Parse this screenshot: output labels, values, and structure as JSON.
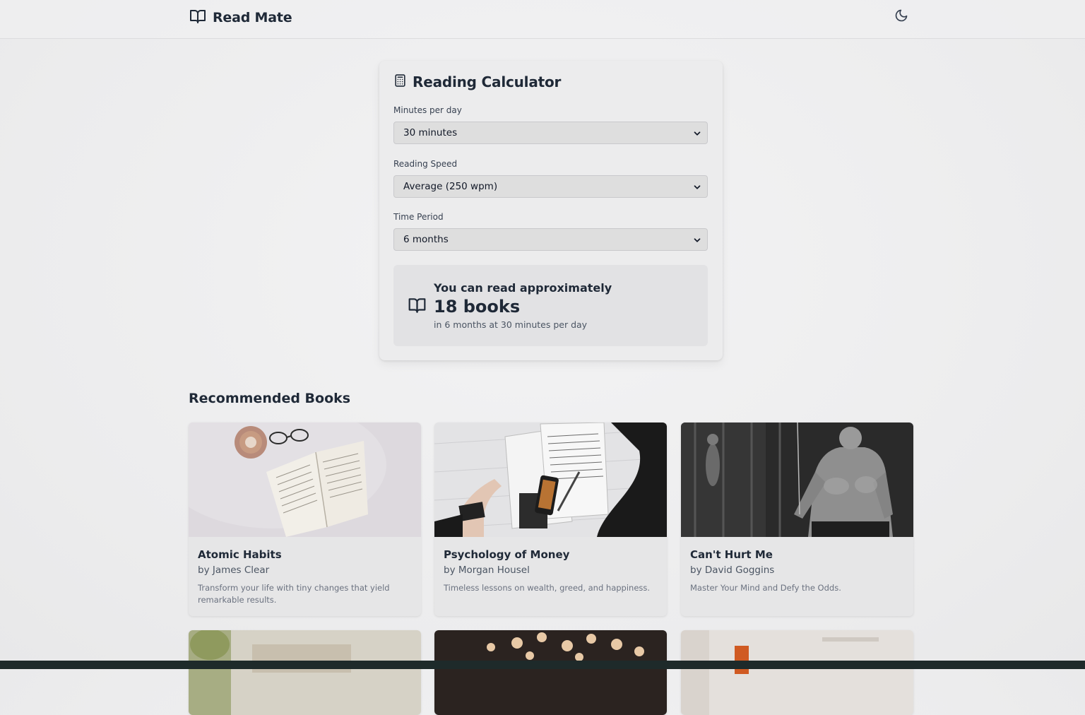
{
  "brand": {
    "name": "Read Mate"
  },
  "calculator": {
    "title": "Reading Calculator",
    "minutes": {
      "label": "Minutes per day",
      "value": "30 minutes"
    },
    "speed": {
      "label": "Reading Speed",
      "value": "Average (250 wpm)"
    },
    "period": {
      "label": "Time Period",
      "value": "6 months"
    },
    "result": {
      "intro": "You can read approximately",
      "count": "18 books",
      "detail": "in 6 months at 30 minutes per day"
    }
  },
  "recommended": {
    "title": "Recommended Books",
    "books": [
      {
        "title": "Atomic Habits",
        "author": "by James Clear",
        "description": "Transform your life with tiny changes that yield remarkable results."
      },
      {
        "title": "Psychology of Money",
        "author": "by Morgan Housel",
        "description": "Timeless lessons on wealth, greed, and happiness."
      },
      {
        "title": "Can't Hurt Me",
        "author": "by David Goggins",
        "description": "Master Your Mind and Defy the Odds."
      }
    ]
  }
}
